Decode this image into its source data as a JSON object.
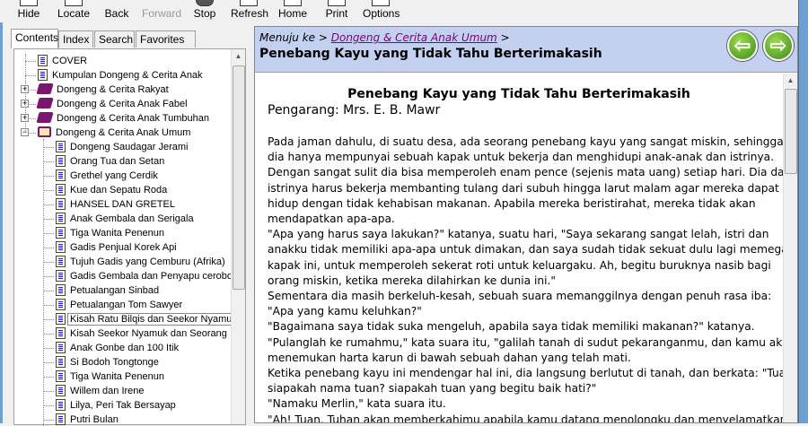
{
  "toolbar": {
    "hide": "Hide",
    "locate": "Locate",
    "back": "Back",
    "forward": "Forward",
    "stop": "Stop",
    "refresh": "Refresh",
    "home": "Home",
    "print": "Print",
    "options": "Options"
  },
  "tabs": [
    "Contents",
    "Index",
    "Search",
    "Favorites"
  ],
  "tree": [
    {
      "label": "COVER",
      "level": 0,
      "type": "page"
    },
    {
      "label": "Kumpulan Dongeng & Cerita Anak",
      "level": 0,
      "type": "page"
    },
    {
      "label": "Dongeng & Cerita Rakyat",
      "level": 0,
      "type": "book"
    },
    {
      "label": "Dongeng & Cerita Anak Fabel",
      "level": 0,
      "type": "book"
    },
    {
      "label": "Dongeng & Cerita Anak Tumbuhan",
      "level": 0,
      "type": "book"
    },
    {
      "label": "Dongeng & Cerita Anak Umum",
      "level": 0,
      "type": "open"
    },
    {
      "label": "Dongeng Saudagar Jerami",
      "level": 1,
      "type": "page"
    },
    {
      "label": "Orang Tua dan Setan",
      "level": 1,
      "type": "page"
    },
    {
      "label": "Grethel yang Cerdik",
      "level": 1,
      "type": "page"
    },
    {
      "label": "Kue dan Sepatu Roda",
      "level": 1,
      "type": "page"
    },
    {
      "label": "HANSEL DAN GRETEL",
      "level": 1,
      "type": "page"
    },
    {
      "label": "Anak Gembala dan Serigala",
      "level": 1,
      "type": "page"
    },
    {
      "label": "Tiga Wanita Penenun",
      "level": 1,
      "type": "page"
    },
    {
      "label": "Gadis Penjual Korek Api",
      "level": 1,
      "type": "page"
    },
    {
      "label": "Tujuh Gadis yang Cemburu (Afrika)",
      "level": 1,
      "type": "page"
    },
    {
      "label": "Gadis Gembala dan Penyapu cerobong",
      "level": 1,
      "type": "page"
    },
    {
      "label": "Petualangan Sinbad",
      "level": 1,
      "type": "page"
    },
    {
      "label": "Petualangan Tom Sawyer",
      "level": 1,
      "type": "page"
    },
    {
      "label": "Kisah Ratu Bilqis dan Seekor Nyamuk",
      "level": 1,
      "type": "page",
      "selected": true
    },
    {
      "label": "Kisah Seekor Nyamuk dan Seorang",
      "level": 1,
      "type": "page"
    },
    {
      "label": "Anak Gonbe dan 100 Itik",
      "level": 1,
      "type": "page"
    },
    {
      "label": "Si Bodoh Tongtonge",
      "level": 1,
      "type": "page"
    },
    {
      "label": "Tiga Wanita Penenun",
      "level": 1,
      "type": "page"
    },
    {
      "label": "Willem dan Irene",
      "level": 1,
      "type": "page"
    },
    {
      "label": "Lilya, Peri Tak Bersayap",
      "level": 1,
      "type": "page"
    },
    {
      "label": "Putri Bulan",
      "level": 1,
      "type": "page"
    }
  ],
  "header": {
    "crumb_prefix": "Menuju ke >",
    "crumb_link": "Dongeng & Cerita Anak Umum",
    "crumb_suffix": ">",
    "title": "Penebang Kayu yang Tidak Tahu Berterimakasih"
  },
  "article": {
    "title": "Penebang Kayu yang Tidak Tahu Berterimakasih",
    "author": "Pengarang: Mrs. E. B. Mawr",
    "lines": [
      "Pada jaman dahulu, di suatu desa, ada seorang penebang kayu yang sangat miskin, sehingga",
      "dia hanya mempunyai sebuah kapak untuk bekerja dan menghidupi anak-anak dan istrinya.",
      "Dengan sangat sulit dia bisa memperoleh enam pence (sejenis mata uang) setiap hari. Dia dan",
      "istrinya harus bekerja membanting tulang dari subuh hingga larut malam agar mereka dapat",
      "hidup dengan tidak kehabisan makanan. Apabila mereka beristirahat, mereka tidak akan",
      "mendapatkan apa-apa.",
      "\"Apa yang harus saya lakukan?\" katanya, suatu hari, \"Saya sekarang sangat lelah, istri dan",
      "anakku tidak memiliki apa-apa untuk dimakan, dan saya sudah tidak sekuat dulu lagi memegang",
      "kapak ini, untuk memperoleh sekerat roti untuk keluargaku. Ah, begitu buruknya nasib bagi",
      "orang miskin, ketika mereka dilahirkan ke dunia ini.\"",
      "Sementara dia masih berkeluh-kesah, sebuah suara memanggilnya dengan penuh rasa iba:",
      "\"Apa yang kamu keluhkan?\"",
      "\"Bagaimana saya tidak suka mengeluh, apabila saya tidak memiliki makanan?\" katanya.",
      "\"Pulanglah ke rumahmu,\" kata suara itu, \"galilah tanah di sudut pekaranganmu, dan kamu akan",
      "menemukan harta karun di bawah sebuah dahan yang telah mati.",
      "Ketika penebang kayu ini mendengar hal ini, dia langsung berlutut di tanah, dan berkata: \"Tuan,",
      "siapakah nama tuan? siapakah tuan yang begitu baik hati?\"",
      "\"Namaku Merlin,\" kata suara itu.",
      "\"Ah! Tuan, Tuhan akan memberkahimu apabila kamu datang menolongku dan menyelamatkan"
    ]
  }
}
